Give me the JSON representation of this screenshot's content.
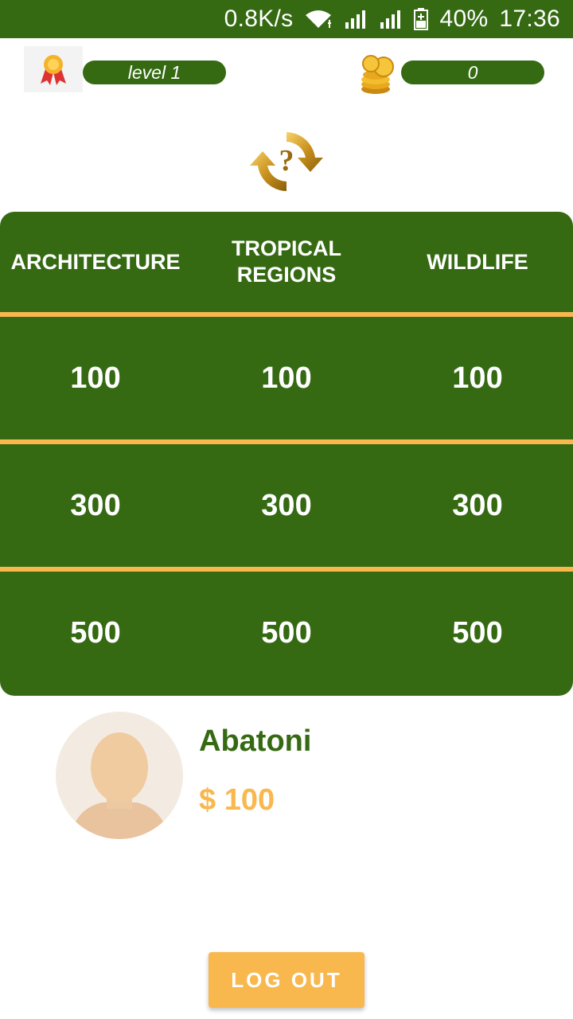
{
  "status_bar": {
    "speed": "0.8K/s",
    "battery": "40%",
    "time": "17:36"
  },
  "top": {
    "level_label": "level 1",
    "coins_value": "0"
  },
  "refresh": {
    "caption": "-"
  },
  "board": {
    "categories": [
      "ARCHITECTURE",
      "TROPICAL\nREGIONS",
      "WILDLIFE"
    ],
    "rows": [
      [
        "100",
        "100",
        "100"
      ],
      [
        "300",
        "300",
        "300"
      ],
      [
        "500",
        "500",
        "500"
      ]
    ]
  },
  "player": {
    "name": "Abatoni",
    "money": "$ 100"
  },
  "logout_label": "LOG OUT",
  "colors": {
    "brand_green": "#356A13",
    "accent_gold": "#F9B84E"
  },
  "icons": {
    "medal": "medal-icon",
    "coins": "coins-icon",
    "refresh": "refresh-question-icon",
    "avatar": "avatar-placeholder"
  }
}
